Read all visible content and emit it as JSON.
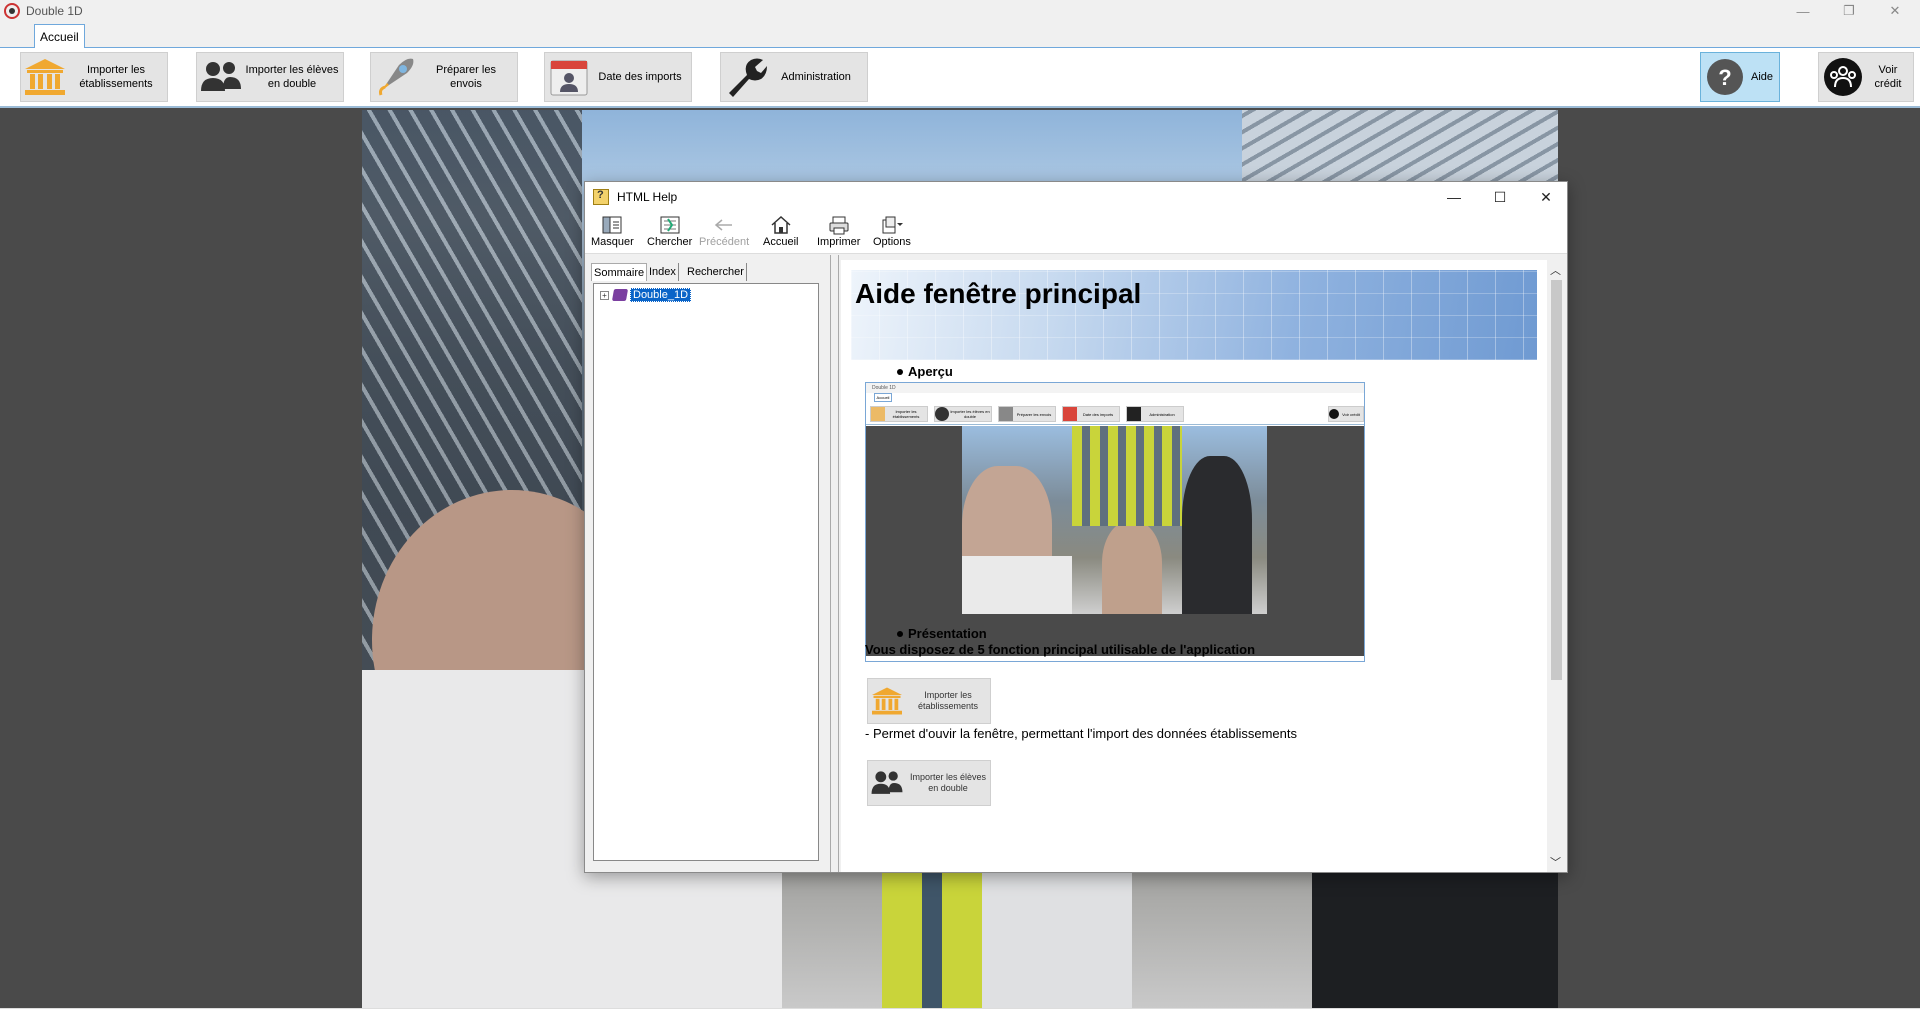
{
  "window": {
    "title": "Double 1D",
    "controls": {
      "minimize": "—",
      "restore": "❐",
      "close": "✕"
    }
  },
  "tabs": [
    {
      "label": "Accueil"
    }
  ],
  "ribbon": {
    "buttons": [
      {
        "label": "Importer les établissements",
        "icon": "bank-icon"
      },
      {
        "label": "Importer les élèves en double",
        "icon": "users-icon"
      },
      {
        "label": "Préparer les envois",
        "icon": "rocket-icon"
      },
      {
        "label": "Date des imports",
        "icon": "calendar-user-icon"
      },
      {
        "label": "Administration",
        "icon": "wrench-icon"
      }
    ],
    "right_buttons": [
      {
        "label": "Aide",
        "icon": "help-icon"
      },
      {
        "label": "Voir crédit",
        "icon": "team-icon"
      }
    ]
  },
  "help_window": {
    "title": "HTML Help",
    "controls": {
      "minimize": "—",
      "maximize": "☐",
      "close": "✕"
    },
    "toolbar": [
      {
        "label": "Masquer",
        "icon": "hide-pane-icon",
        "enabled": true
      },
      {
        "label": "Chercher",
        "icon": "locate-icon",
        "enabled": true
      },
      {
        "label": "Précédent",
        "icon": "back-arrow-icon",
        "enabled": false
      },
      {
        "label": "Accueil",
        "icon": "home-icon",
        "enabled": true
      },
      {
        "label": "Imprimer",
        "icon": "printer-icon",
        "enabled": true
      },
      {
        "label": "Options",
        "icon": "options-icon",
        "enabled": true
      }
    ],
    "nav_tabs": [
      {
        "label": "Sommaire",
        "active": true
      },
      {
        "label": "Index",
        "active": false
      },
      {
        "label": "Rechercher",
        "active": false
      }
    ],
    "tree": [
      {
        "label": "Double_1D",
        "expander": "+",
        "selected": true
      }
    ],
    "content": {
      "heading": "Aide fenêtre principal",
      "section1": "Aperçu",
      "section2": "Présentation",
      "intro": "Vous disposez de 5 fonction principal utilisable de l'application",
      "feature1": {
        "button_label": "Importer les établissements",
        "description": "- Permet d'ouvir la fenêtre, permettant l'import des données établissements"
      },
      "feature2": {
        "button_label": "Importer les élèves en double"
      },
      "preview": {
        "title": "Double 1D",
        "tab": "Accueil",
        "buttons": [
          "Importer les établissements",
          "Importer les élèves en double",
          "Préparer les envois",
          "Date des imports",
          "Administration"
        ],
        "right_button": "Voir crédit"
      }
    }
  },
  "colors": {
    "accent": "#6ab2db",
    "button_bg": "#e4e4e4",
    "selection": "#0a64c8",
    "workspace": "#4a4a4a",
    "bank_orange": "#f0a830"
  }
}
